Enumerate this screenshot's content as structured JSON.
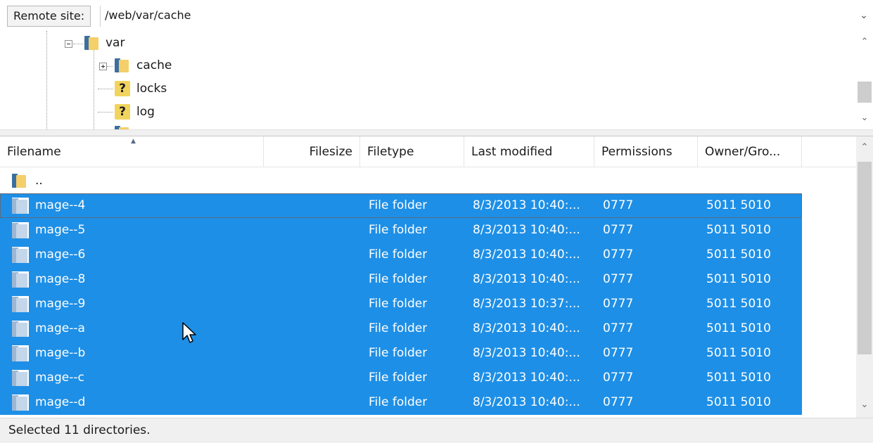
{
  "remote_site": {
    "label": "Remote site:",
    "path": "/web/var/cache"
  },
  "tree": {
    "items": [
      {
        "label": "var",
        "icon": "folder-icon",
        "expander": "minus"
      },
      {
        "label": "cache",
        "icon": "folder-icon",
        "expander": "plus"
      },
      {
        "label": "locks",
        "icon": "unknown-icon",
        "glyph": "?"
      },
      {
        "label": "log",
        "icon": "unknown-icon",
        "glyph": "?"
      }
    ]
  },
  "columns": [
    "Filename",
    "Filesize",
    "Filetype",
    "Last modified",
    "Permissions",
    "Owner/Gro..."
  ],
  "parent_row": {
    "name": ".."
  },
  "rows": [
    {
      "name": "mage--4",
      "filetype": "File folder",
      "modified": "8/3/2013 10:40:...",
      "permissions": "0777",
      "owner": "5011 5010"
    },
    {
      "name": "mage--5",
      "filetype": "File folder",
      "modified": "8/3/2013 10:40:...",
      "permissions": "0777",
      "owner": "5011 5010"
    },
    {
      "name": "mage--6",
      "filetype": "File folder",
      "modified": "8/3/2013 10:40:...",
      "permissions": "0777",
      "owner": "5011 5010"
    },
    {
      "name": "mage--8",
      "filetype": "File folder",
      "modified": "8/3/2013 10:40:...",
      "permissions": "0777",
      "owner": "5011 5010"
    },
    {
      "name": "mage--9",
      "filetype": "File folder",
      "modified": "8/3/2013 10:37:...",
      "permissions": "0777",
      "owner": "5011 5010"
    },
    {
      "name": "mage--a",
      "filetype": "File folder",
      "modified": "8/3/2013 10:40:...",
      "permissions": "0777",
      "owner": "5011 5010"
    },
    {
      "name": "mage--b",
      "filetype": "File folder",
      "modified": "8/3/2013 10:40:...",
      "permissions": "0777",
      "owner": "5011 5010"
    },
    {
      "name": "mage--c",
      "filetype": "File folder",
      "modified": "8/3/2013 10:40:...",
      "permissions": "0777",
      "owner": "5011 5010"
    },
    {
      "name": "mage--d",
      "filetype": "File folder",
      "modified": "8/3/2013 10:40:...",
      "permissions": "0777",
      "owner": "5011 5010"
    }
  ],
  "status": "Selected 11 directories.",
  "colors": {
    "selection": "#1e8fe6",
    "folder": "#f4cf6a"
  }
}
